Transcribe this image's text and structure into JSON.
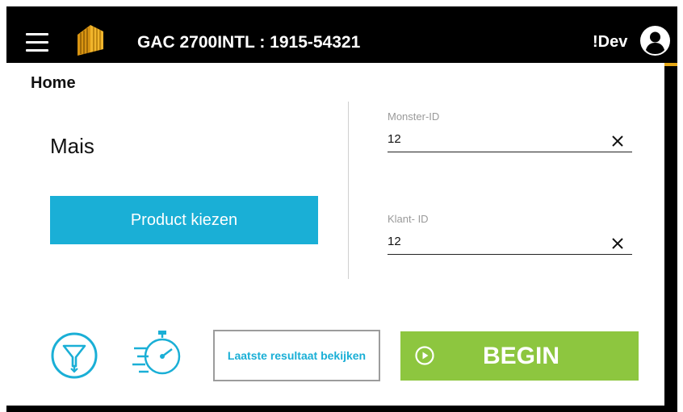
{
  "header": {
    "title": "GAC 2700INTL : 1915-54321",
    "user": "!Dev",
    "menu_icon": "hamburger-icon",
    "logo_icon": "brand-logo",
    "avatar_icon": "user-avatar-icon"
  },
  "page": {
    "title": "Home"
  },
  "product": {
    "name": "Mais",
    "choose_label": "Product kiezen"
  },
  "fields": {
    "sample_id": {
      "label": "Monster-ID",
      "value": "12"
    },
    "customer_id": {
      "label": "Klant- ID",
      "value": "12"
    }
  },
  "actions": {
    "latest_results_label": "Laatste resultaat bekijken",
    "begin_label": "BEGIN",
    "funnel_icon": "funnel-icon",
    "timer_icon": "fast-timer-icon",
    "play_icon": "play-circle-icon"
  },
  "colors": {
    "accent_blue": "#1aafd6",
    "begin_green": "#8dc63f",
    "header_line_gold": "#e6a817"
  }
}
